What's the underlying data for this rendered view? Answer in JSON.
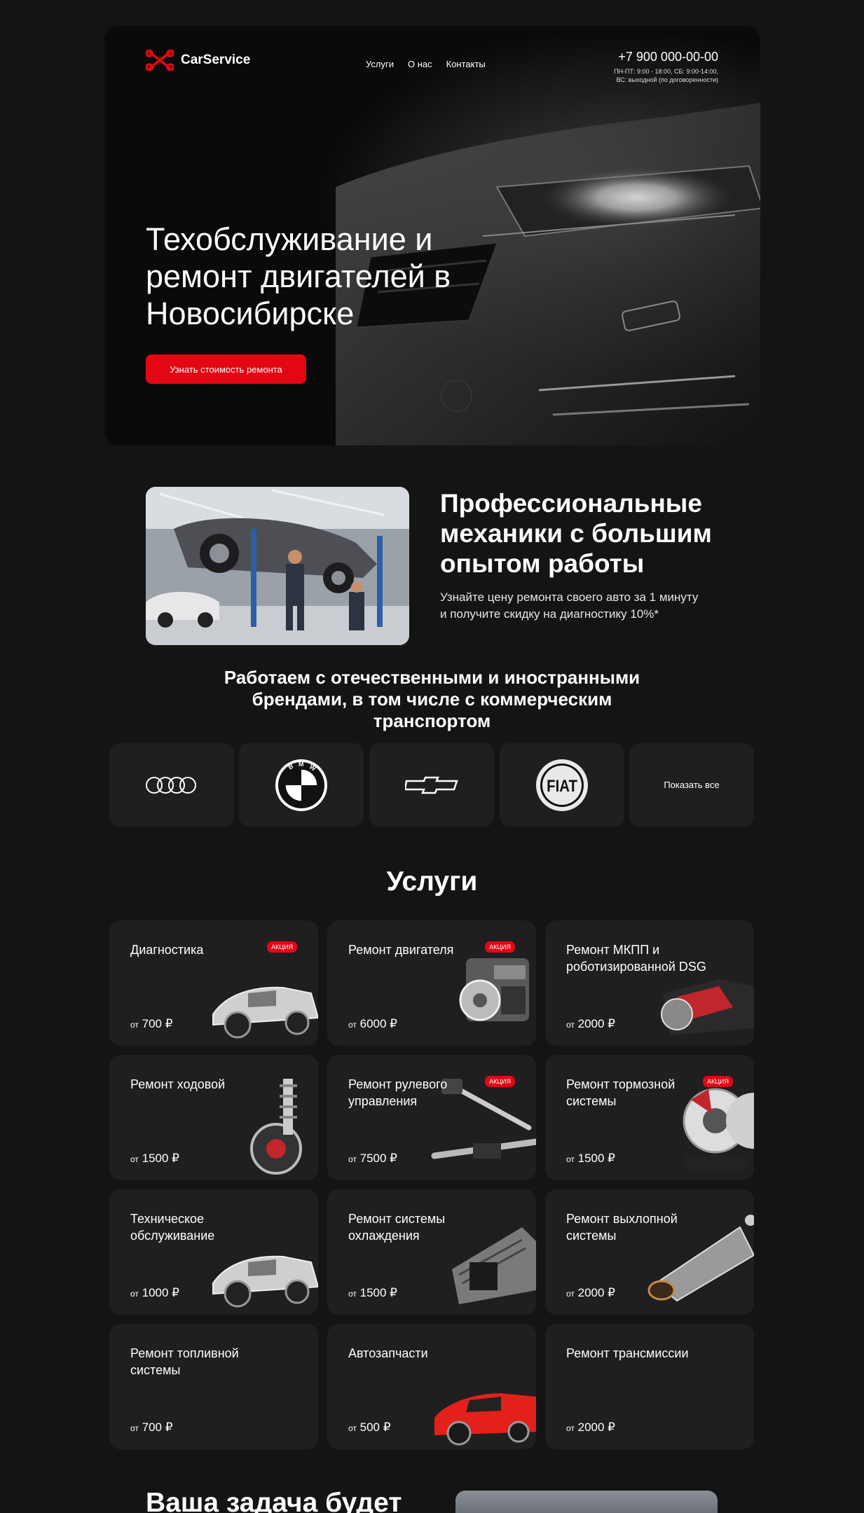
{
  "header": {
    "logo_text": "CarService",
    "menu": [
      "Услуги",
      "О нас",
      "Контакты"
    ],
    "phone": "+7 900 000-00-00",
    "hours_line1": "ПН-ПТ: 9:00 - 18:00, СБ: 9:00-14:00,",
    "hours_line2": "ВС: выходной (по договоренности)"
  },
  "hero": {
    "title": "Техобслуживание и ремонт двигателей в Новосибирске",
    "button": "Узнать стоимость ремонта"
  },
  "mechanics": {
    "title": "Профессиональные механики с большим опытом работы",
    "text": "Узнайте цену ремонта своего авто за 1 минуту и получите скидку на диагностику 10%*"
  },
  "brands": {
    "title": "Работаем с отечественными и иностранными брендами, в том числе с коммерческим транспортом",
    "items": [
      "audi-logo",
      "bmw-logo",
      "chevrolet-logo",
      "fiat-logo"
    ],
    "show_all": "Показать все"
  },
  "services": {
    "title": "Услуги",
    "price_prefix": "от",
    "badge": "АКЦИЯ",
    "items": [
      {
        "title": "Диагностика",
        "price": "700 ₽",
        "badge": true
      },
      {
        "title": "Ремонт двигателя",
        "price": "6000 ₽",
        "badge": true
      },
      {
        "title": "Ремонт МКПП и роботизированной DSG",
        "price": "2000 ₽",
        "badge": false
      },
      {
        "title": "Ремонт ходовой",
        "price": "1500 ₽",
        "badge": false
      },
      {
        "title": "Ремонт рулевого управления",
        "price": "7500 ₽",
        "badge": true
      },
      {
        "title": "Ремонт тормозной системы",
        "price": "1500 ₽",
        "badge": true
      },
      {
        "title": "Техническое обслуживание",
        "price": "1000 ₽",
        "badge": false
      },
      {
        "title": "Ремонт системы охлаждения",
        "price": "1500 ₽",
        "badge": false
      },
      {
        "title": "Ремонт выхлопной системы",
        "price": "2000 ₽",
        "badge": false
      },
      {
        "title": "Ремонт топливной системы",
        "price": "700 ₽",
        "badge": false
      },
      {
        "title": "Автозапчасти",
        "price": "500 ₽",
        "badge": false
      },
      {
        "title": "Ремонт трансмиссии",
        "price": "2000 ₽",
        "badge": false
      }
    ]
  },
  "bottom": {
    "title": "Ваша задача будет"
  },
  "colors": {
    "background": "#141414",
    "card": "#1f1f1f",
    "accent": "#e30613"
  }
}
